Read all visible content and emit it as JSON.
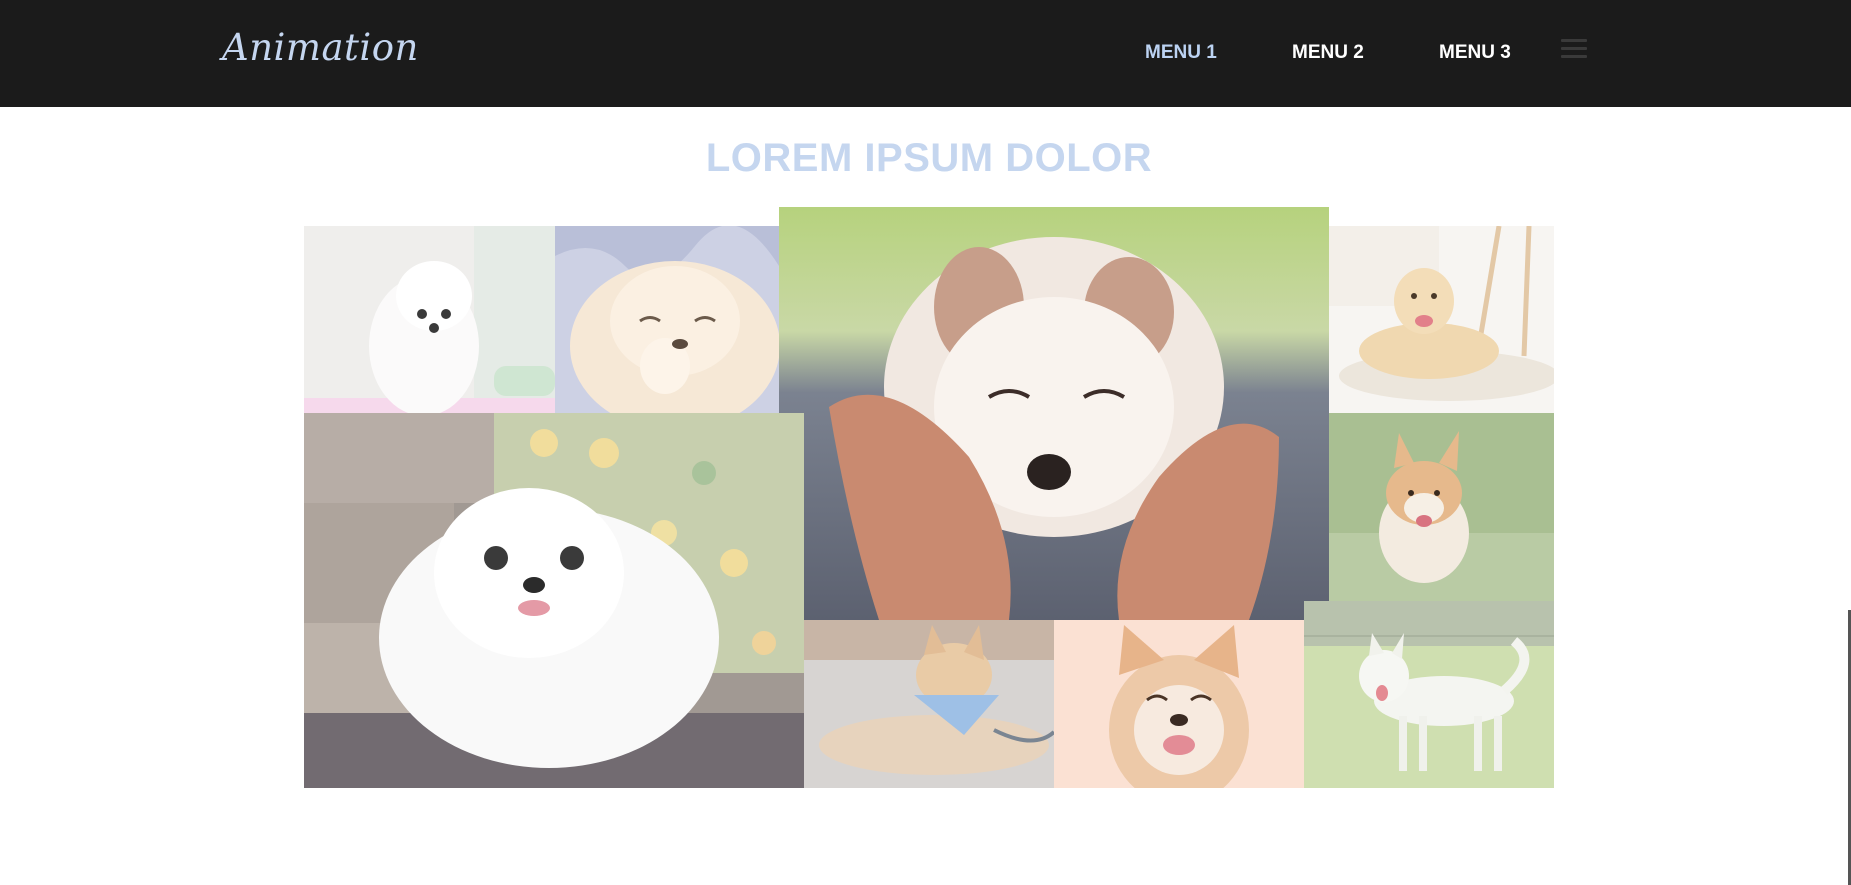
{
  "header": {
    "logo": "Animation",
    "menu": [
      {
        "label": "MENU 1",
        "active": true
      },
      {
        "label": "MENU 2",
        "active": false
      },
      {
        "label": "MENU 3",
        "active": false
      }
    ]
  },
  "main": {
    "title": "LOREM IPSUM DOLOR"
  },
  "gallery": [
    {
      "icon": "white-pomeranian-puppy-photo"
    },
    {
      "icon": "laughing-fluffy-puppy-photo"
    },
    {
      "icon": "puppy-face-in-hands-photo"
    },
    {
      "icon": "golden-retriever-lying-photo"
    },
    {
      "icon": "white-pomeranian-by-flowers-photo"
    },
    {
      "icon": "running-corgi-photo"
    },
    {
      "icon": "shiba-inu-with-bandana-photo"
    },
    {
      "icon": "smiling-shiba-inu-photo"
    },
    {
      "icon": "white-dog-on-grass-photo"
    }
  ],
  "colors": {
    "navbar": "#1b1b1b",
    "accent": "#c5d6ef",
    "menu_active": "#bcd3f3",
    "menu": "#ffffff"
  }
}
